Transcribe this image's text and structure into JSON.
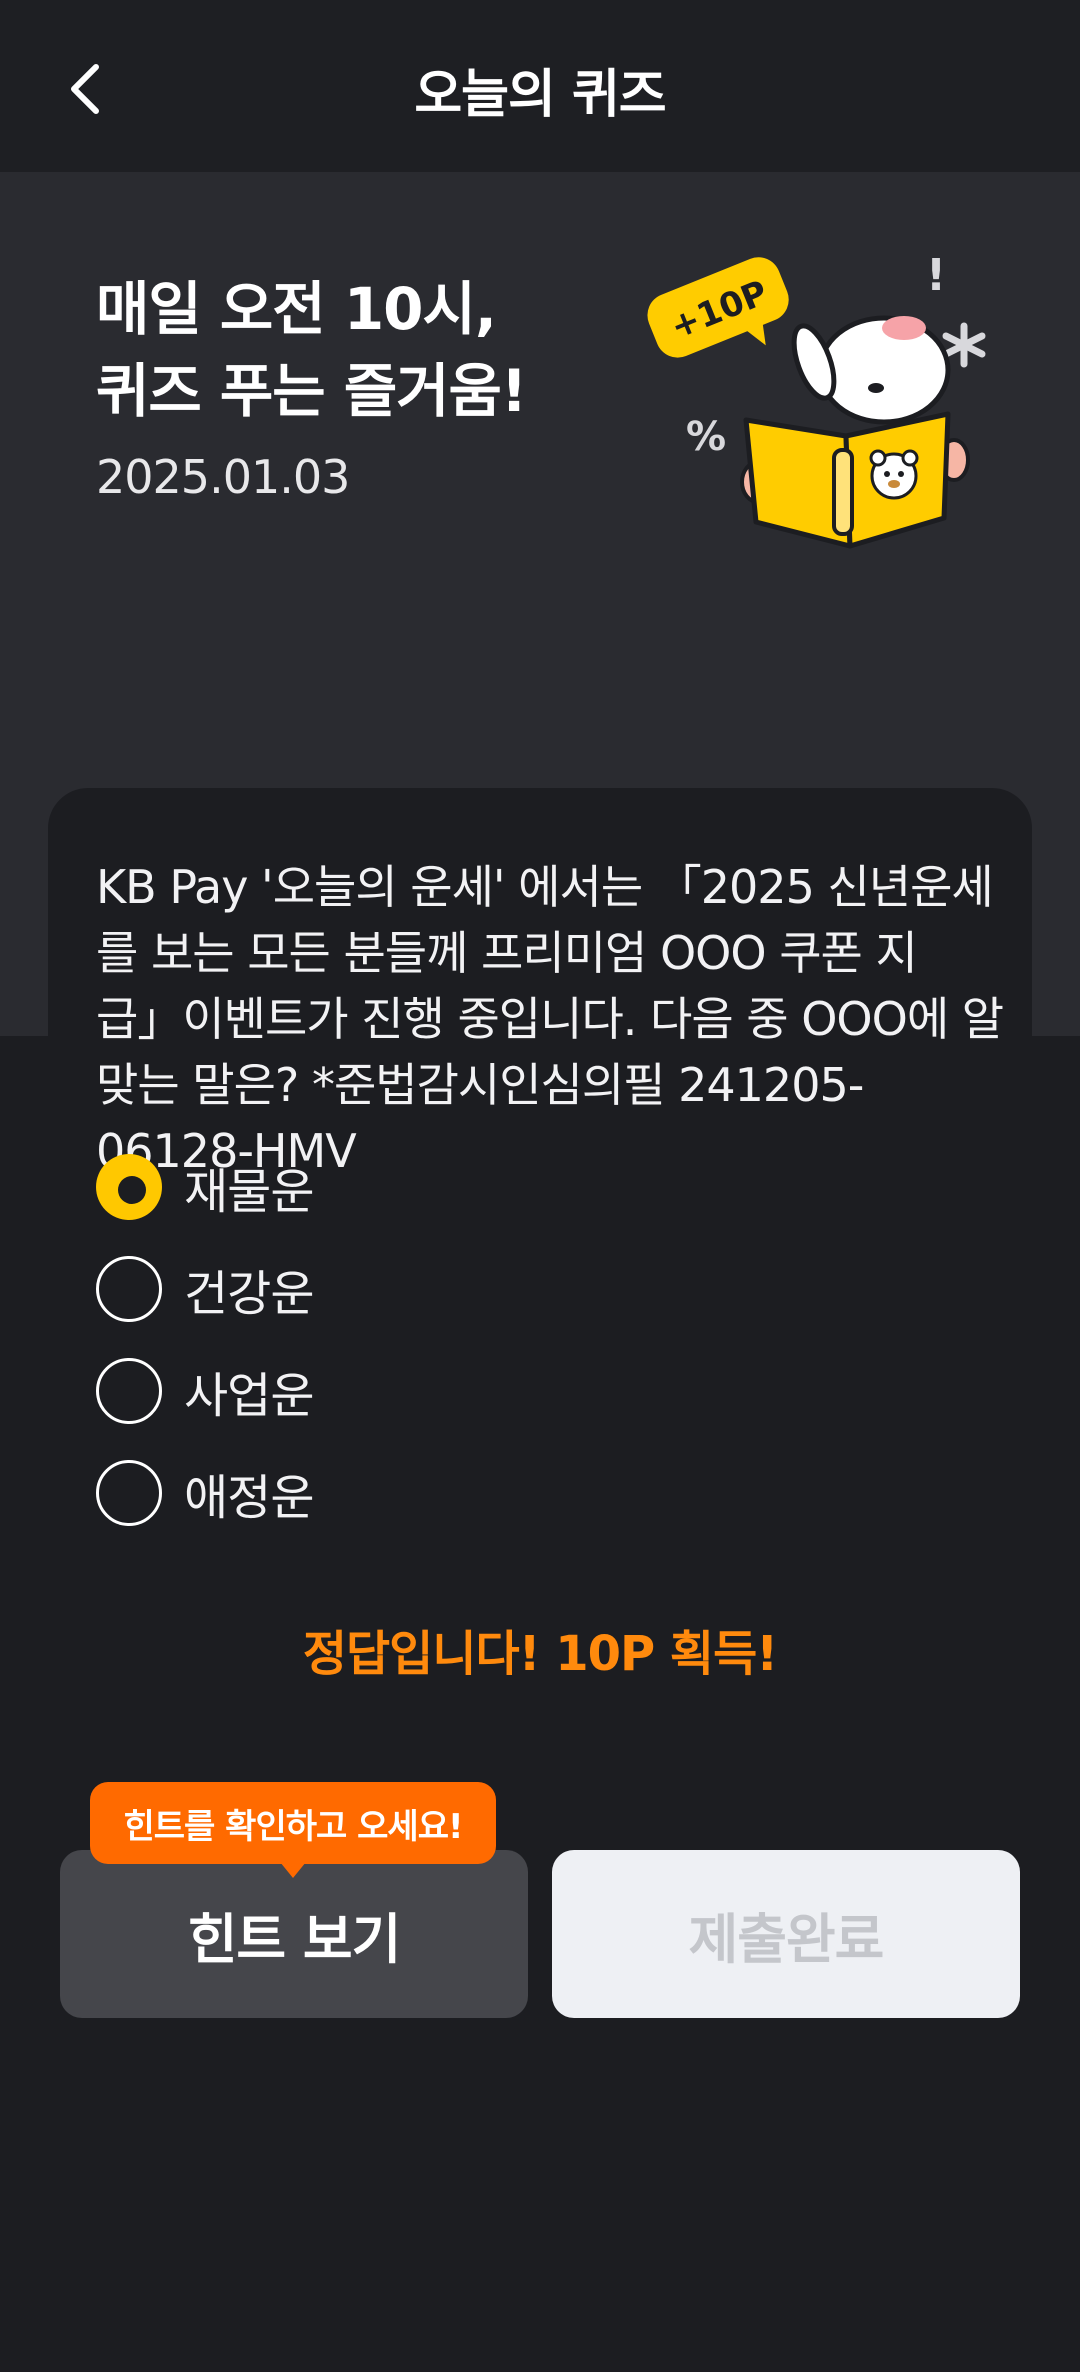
{
  "header": {
    "title": "오늘의 퀴즈"
  },
  "hero": {
    "title_line1": "매일 오전 10시,",
    "title_line2": "퀴즈 푸는 즐거움!",
    "date": "2025.01.03",
    "badge": "+10P"
  },
  "question": {
    "lines": [
      "KB Pay '오늘의 운세' 에서는 「2025 신년운세",
      "를 보는 모든 분들께 프리미엄 OOO 쿠폰 지",
      "급」이벤트가 진행 중입니다. 다음 중 OOO에 알",
      "맞는 말은? *준법감시인심의필 241205-",
      "06128-HMV"
    ]
  },
  "options": [
    {
      "label": "재물운",
      "selected": true
    },
    {
      "label": "건강운",
      "selected": false
    },
    {
      "label": "사업운",
      "selected": false
    },
    {
      "label": "애정운",
      "selected": false
    }
  ],
  "result": "정답입니다! 10P 획득!",
  "tooltip": "힌트를 확인하고 오세요!",
  "buttons": {
    "hint_label": "힌트 보기",
    "submit_label": "제출완료"
  },
  "colors": {
    "accent_yellow": "#ffc800",
    "accent_orange": "#ff6a00",
    "result_orange": "#ff8a0d",
    "background": "#1c1d21"
  }
}
